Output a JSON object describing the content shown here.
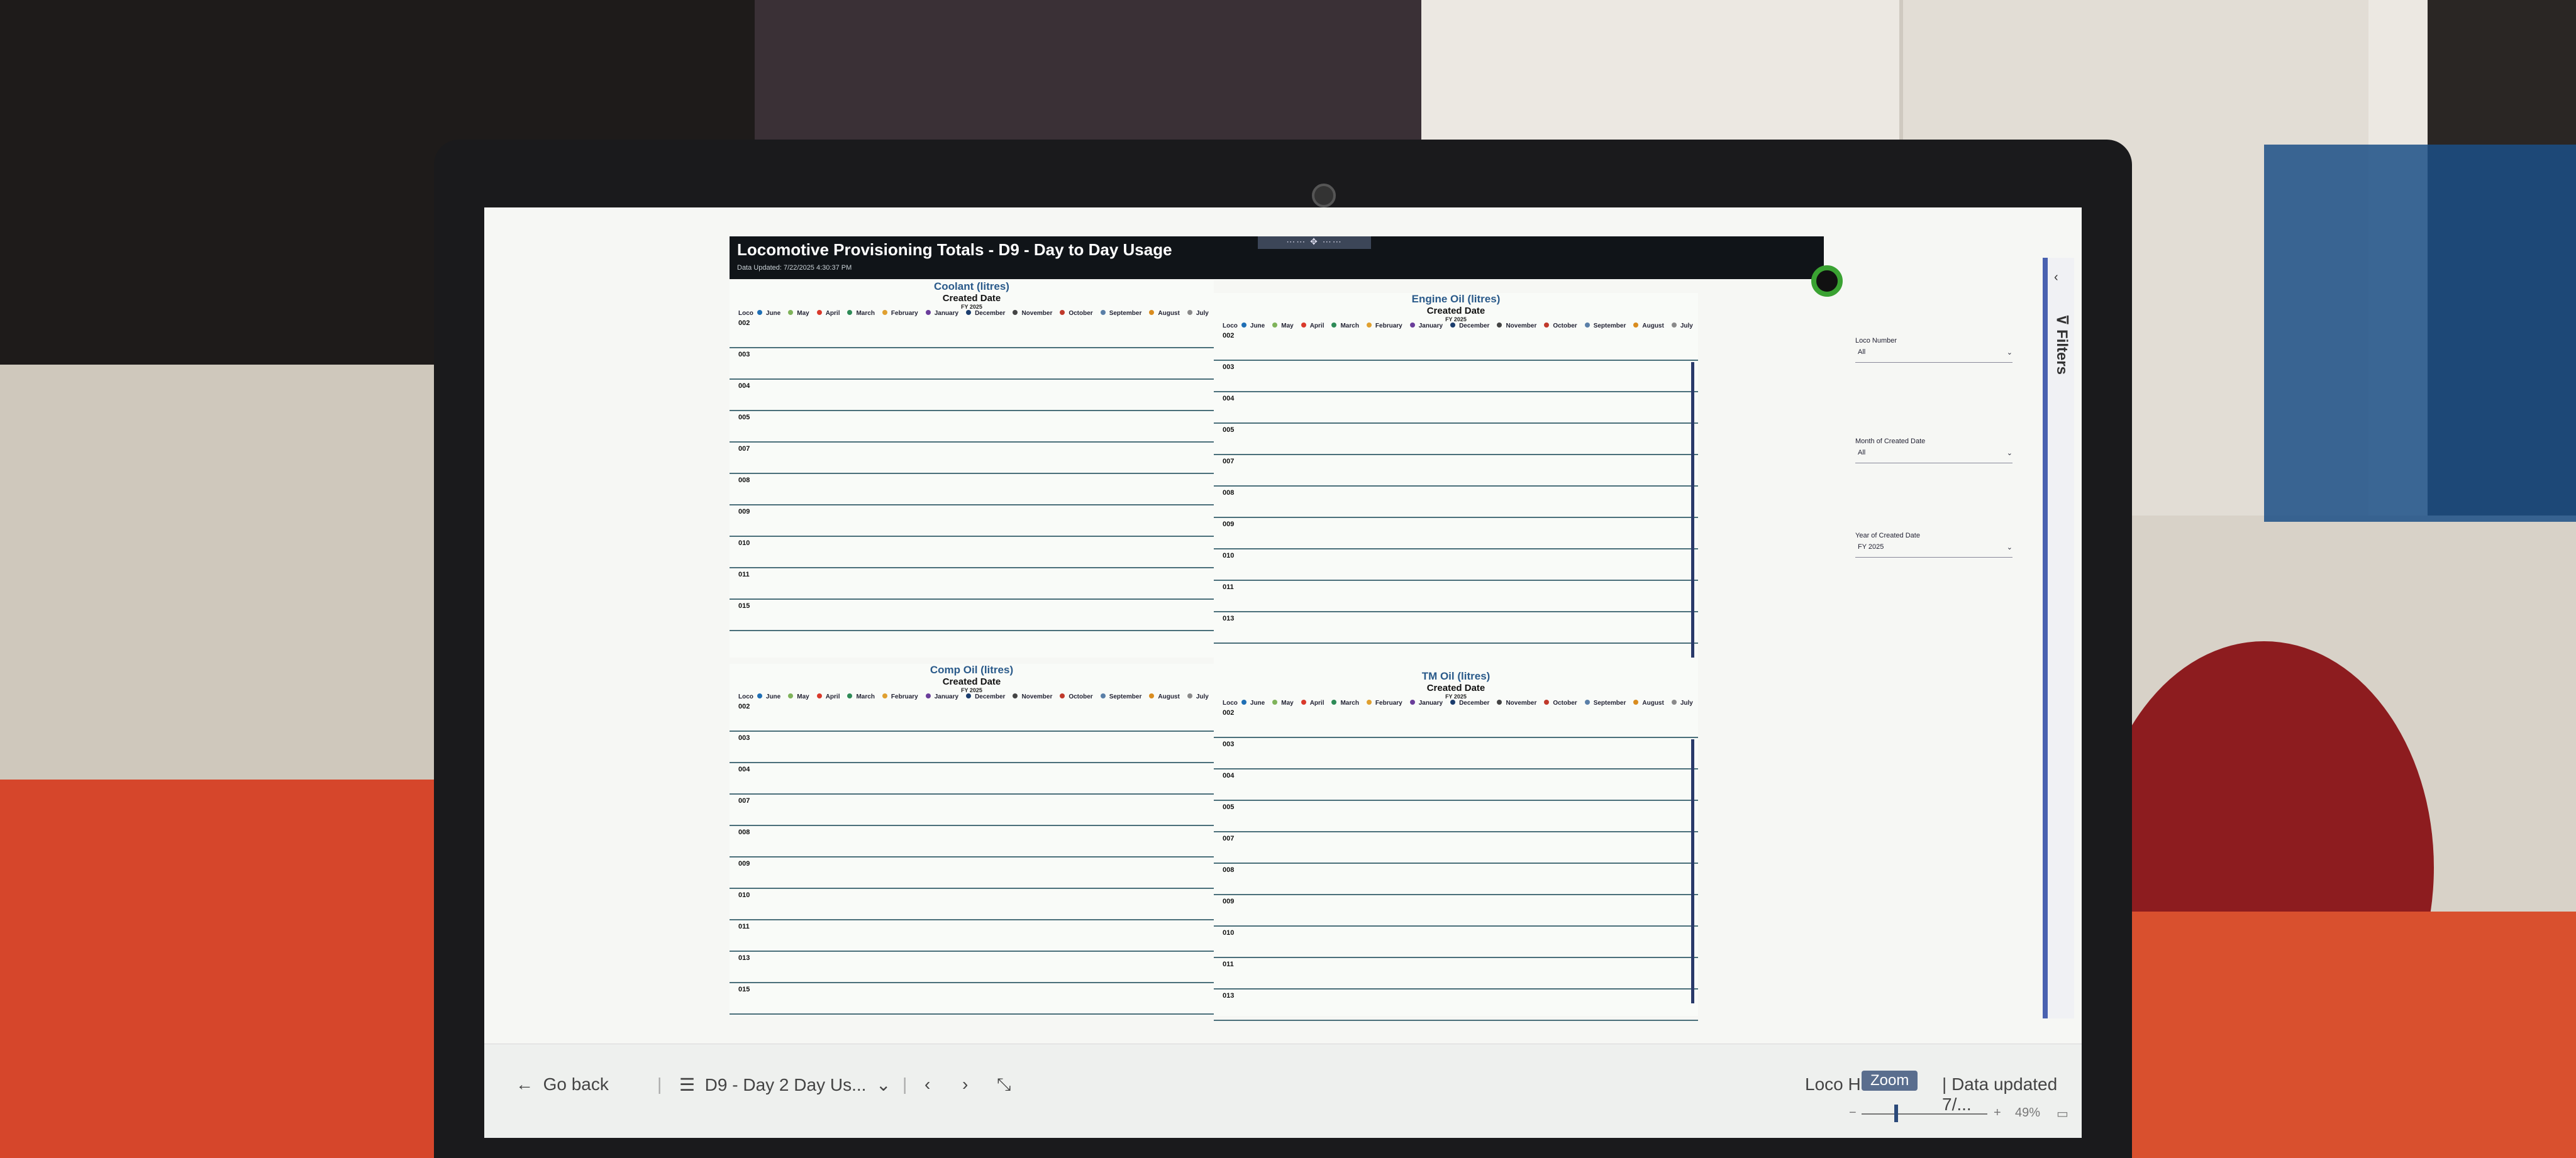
{
  "report": {
    "title": "Locomotive Provisioning Totals - D9 - Day to Day Usage",
    "data_updated": "Data Updated: 7/22/2025 4:30:37 PM"
  },
  "legend_months": [
    "June",
    "May",
    "April",
    "March",
    "February",
    "January",
    "December",
    "November",
    "October",
    "September",
    "August",
    "July"
  ],
  "month_colors": {
    "June": "#1f6fb5",
    "May": "#7fb35a",
    "April": "#d9392b",
    "March": "#2e8b57",
    "February": "#e0a030",
    "January": "#6a3d9a",
    "December": "#1b3d6e",
    "November": "#444444",
    "October": "#c0392b",
    "September": "#5a7fa8",
    "August": "#d98c1f",
    "July": "#8a8a8a"
  },
  "visuals": {
    "coolant": {
      "title": "Coolant (litres)",
      "subtitle": "Created Date",
      "fy": "FY 2025",
      "loco_header": "Loco",
      "rows": [
        "002",
        "003",
        "004",
        "005",
        "007",
        "008",
        "009",
        "010",
        "011",
        "015"
      ]
    },
    "engine": {
      "title": "Engine Oil (litres)",
      "subtitle": "Created Date",
      "fy": "FY 2025",
      "loco_header": "Loco",
      "rows": [
        "002",
        "003",
        "004",
        "005",
        "007",
        "008",
        "009",
        "010",
        "011",
        "013"
      ]
    },
    "comp": {
      "title": "Comp Oil (litres)",
      "subtitle": "Created Date",
      "fy": "FY 2025",
      "loco_header": "Loco",
      "rows": [
        "002",
        "003",
        "004",
        "007",
        "008",
        "009",
        "010",
        "011",
        "013",
        "015"
      ]
    },
    "tm": {
      "title": "TM Oil (litres)",
      "subtitle": "Created Date",
      "fy": "FY 2025",
      "loco_header": "Loco",
      "rows": [
        "002",
        "003",
        "004",
        "005",
        "007",
        "008",
        "009",
        "010",
        "011",
        "013"
      ]
    }
  },
  "slicers": [
    {
      "label": "Loco Number",
      "value": "All"
    },
    {
      "label": "Month of Created Date",
      "value": "All"
    },
    {
      "label": "Year of Created Date",
      "value": "FY 2025"
    }
  ],
  "filters_pane": {
    "label": "Filters"
  },
  "bottom_bar": {
    "go_back": "Go back",
    "page_name": "D9 - Day 2 Day Us...",
    "loco": "Loco Ha",
    "zoom_tooltip": "Zoom",
    "data_updated": "Data updated 7/...",
    "zoom_level": "49%"
  },
  "icons": {
    "back": "arrow-left-icon",
    "pages": "pages-list-icon",
    "dropdown": "chevron-down-icon",
    "prev": "chevron-left-icon",
    "next": "chevron-right-icon",
    "collapse": "collapse-icon",
    "fit": "fit-to-page-icon",
    "filter": "filter-icon"
  }
}
